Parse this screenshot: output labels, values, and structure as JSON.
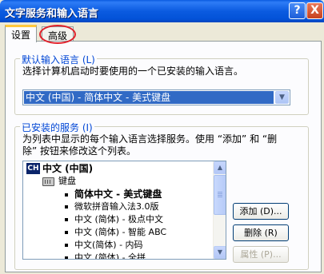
{
  "window": {
    "title": "文字服务和输入语言",
    "help_button": "?",
    "close_button": "X"
  },
  "tabs": [
    {
      "label": "设置",
      "active": true
    },
    {
      "label": "高级",
      "active": false,
      "circled": true
    }
  ],
  "default_language": {
    "group_label": "默认输入语言 (L)",
    "description": "选择计算机启动时要使用的一个已安装的输入语言。",
    "selected": "中文 (中国) - 简体中文 - 美式键盘"
  },
  "installed_services": {
    "group_label": "已安装的服务 (I)",
    "description_line1": "为列表中显示的每个输入语言选择服务。使用 “添加” 和 “删",
    "description_line2": "除” 按钮来修改这个列表。",
    "tree": {
      "language": {
        "icon": "CH",
        "label": "中文 (中国)"
      },
      "category": "键盘",
      "items": [
        "简体中文 - 美式键盘",
        "微软拼音输入法3.0版",
        "中文 (简体) - 极点中文",
        "中文 (简体) - 智能 ABC",
        "中文(简体) - 内码",
        "中文 (简体) - 全拼"
      ]
    },
    "buttons": {
      "add": "添加 (D)...",
      "remove": "删除 (R)",
      "properties": "属性 (P)..."
    }
  }
}
